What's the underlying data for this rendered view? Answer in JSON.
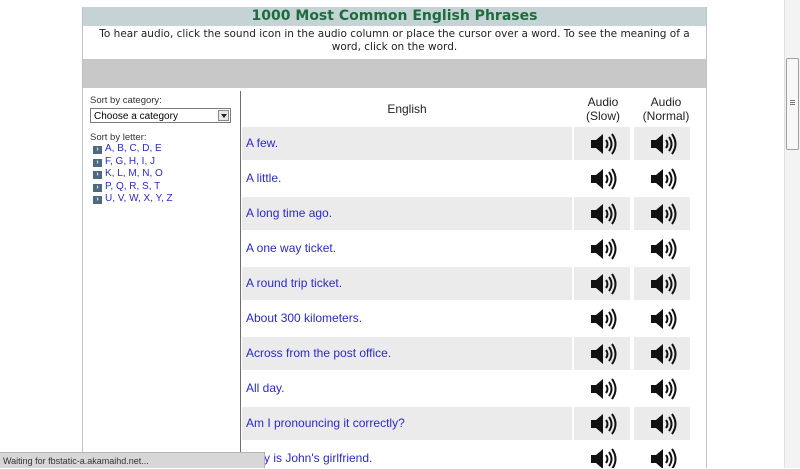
{
  "page": {
    "title": "1000 Most Common English Phrases",
    "instructions": "To hear audio, click the sound icon in the audio column or place the cursor over a word. To see the meaning of a word, click on the word."
  },
  "sidebar": {
    "category_label": "Sort by category:",
    "category_select": "Choose a category",
    "letter_label": "Sort by letter:",
    "letters": [
      "A, B, C, D, E",
      "F, G, H, I, J",
      "K, L, M, N, O",
      "P, Q, R, S, T",
      "U, V, W, X, Y, Z"
    ]
  },
  "table": {
    "col_english": "English",
    "col_slow_line1": "Audio",
    "col_slow_line2": "(Slow)",
    "col_normal_line1": "Audio",
    "col_normal_line2": "(Normal)",
    "rows": [
      "A few.",
      "A little.",
      "A long time ago.",
      "A one way ticket.",
      "A round trip ticket.",
      "About 300 kilometers.",
      "Across from the post office.",
      "All day.",
      "Am I pronouncing it correctly?",
      "Amy is John's girlfriend."
    ]
  },
  "status_bar": {
    "text": "Waiting for fbstatic-a.akamaihd.net..."
  }
}
